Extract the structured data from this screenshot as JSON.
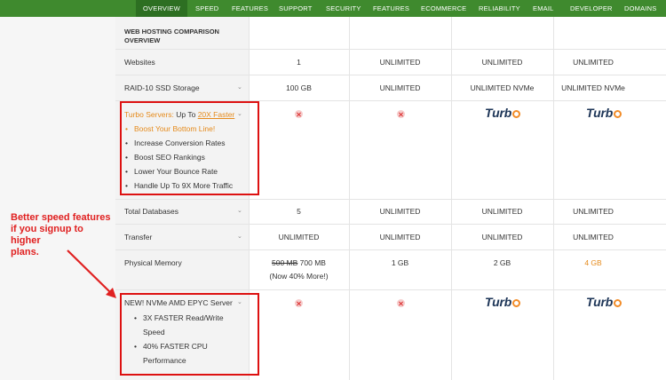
{
  "nav": {
    "items": [
      "OVERVIEW",
      "SPEED",
      "FEATURES",
      "SUPPORT",
      "SECURITY",
      "FEATURES",
      "ECOMMERCE",
      "RELIABILITY",
      "EMAIL",
      "DEVELOPER",
      "DOMAINS"
    ],
    "active_index": 0
  },
  "table": {
    "header_title_line1": "WEB HOSTING COMPARISON",
    "header_title_line2": "OVERVIEW",
    "rows": {
      "websites": {
        "label": "Websites",
        "values": [
          "1",
          "UNLIMITED",
          "UNLIMITED",
          "UNLIMITED"
        ]
      },
      "storage": {
        "label": "RAID-10 SSD Storage",
        "values": [
          "100 GB",
          "UNLIMITED",
          "UNLIMITED NVMe",
          "UNLIMITED NVMe"
        ]
      },
      "turbo": {
        "label_prefix": "Turbo Servers:",
        "label_middle": " Up To ",
        "label_link": "20X Faster",
        "bullets": [
          "Boost Your Bottom Line!",
          "Increase Conversion Rates",
          "Boost SEO Rankings",
          "Lower Your Bounce Rate",
          "Handle Up To 9X More Traffic"
        ],
        "logo_text": "Turb"
      },
      "databases": {
        "label": "Total Databases",
        "values": [
          "5",
          "UNLIMITED",
          "UNLIMITED",
          "UNLIMITED"
        ]
      },
      "transfer": {
        "label": "Transfer",
        "values": [
          "UNLIMITED",
          "UNLIMITED",
          "UNLIMITED",
          "UNLIMITED"
        ]
      },
      "memory": {
        "label": "Physical Memory",
        "old_value": "500 MB",
        "new_value": " 700 MB",
        "note": "(Now 40% More!)",
        "values": [
          "1 GB",
          "2 GB",
          "4 GB"
        ]
      },
      "nvme": {
        "label": "NEW! NVMe AMD EPYC Server",
        "bullets_line1": [
          "3X FASTER Read/Write",
          "40% FASTER CPU"
        ],
        "bullets_line2": [
          "Speed",
          "Performance"
        ],
        "logo_text": "Turb"
      }
    }
  },
  "annotation": {
    "text_lines": [
      "Better speed features",
      "if you signup to higher",
      "plans."
    ]
  },
  "colors": {
    "nav_green": "#3f8a2e",
    "annotation_red": "#e02020",
    "orange": "#e58a1b",
    "turbo_blue": "#1d3557"
  }
}
